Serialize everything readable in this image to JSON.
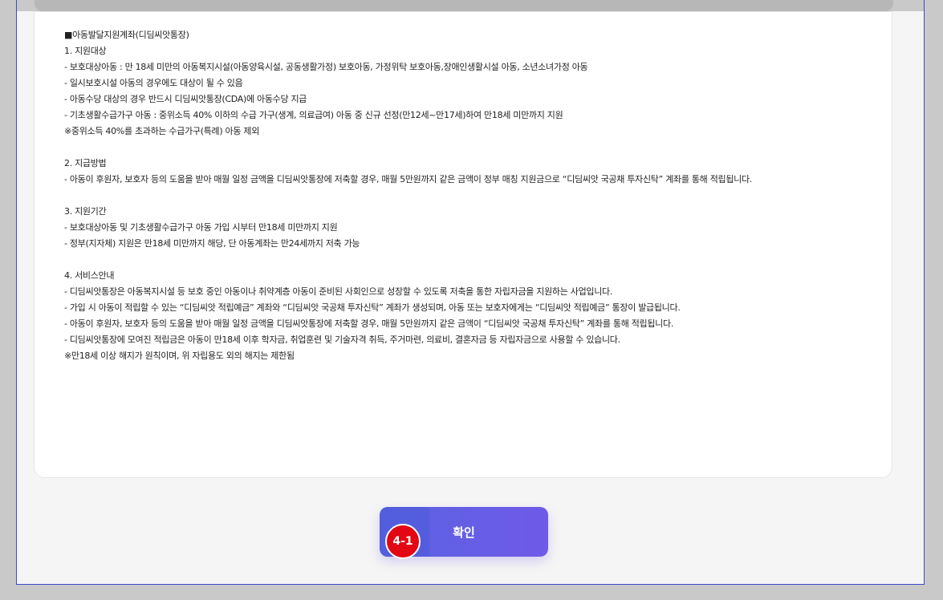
{
  "content": {
    "title": "■아동발달지원계좌(디딤씨앗통장)",
    "sections": [
      {
        "heading": "1. 지원대상",
        "lines": [
          "- 보호대상아동 : 만 18세 미만의 아동복지시설(아동양육시설, 공동생활가정) 보호아동, 가정위탁 보호아동,장애인생활시설 아동, 소년소녀가정 아동",
          "- 일시보호시설 아동의 경우에도 대상이 될 수 있음",
          "- 아동수당 대상의 경우 반드시 디딤씨앗통장(CDA)에 아동수당 지급",
          "- 기초생활수급가구 아동 : 중위소득 40% 이하의 수급 가구(생계, 의료급여) 아동 중 신규 선정(만12세~만17세)하여 만18세 미만까지 지원",
          " ※중위소득 40%를 초과하는 수급가구(특례) 아동 제외"
        ]
      },
      {
        "heading": "2. 지급방법",
        "lines": [
          "- 아동이 후원자, 보호자 등의 도움을 받아 매월 일정 금액을 디딤씨앗통장에 저축할 경우, 매월 5만원까지 같은 금액이 정부 매칭 지원금으로 “디딤씨앗 국공채 투자신탁” 계좌를 통해 적립됩니다."
        ]
      },
      {
        "heading": "3. 지원기간",
        "lines": [
          "- 보호대상아동 및 기초생활수급가구 아동 가입 시부터 만18세 미만까지 지원",
          "- 정부(지자체) 지원은 만18세 미만까지 해당, 단 아동계좌는 만24세까지 저축 가능"
        ]
      },
      {
        "heading": "4. 서비스안내",
        "lines": [
          "- 디딤씨앗통장은 아동복지시설 등 보호 중인 아동이나 취약계층 아동이 준비된 사회인으로 성장할 수 있도록 저축을 통한 자립자금을 지원하는 사업입니다.",
          "- 가입 시 아동이 적립할 수 있는 “디딤씨앗 적립예금” 계좌와 “디딤씨앗 국공채 투자신탁” 계좌가 생성되며, 아동 또는 보호자에게는 “디딤씨앗 적립예금” 통장이 발급됩니다.",
          "- 아동이 후원자, 보호자 등의 도움을 받아 매월 일정 금액을 디딤씨앗통장에 저축할 경우, 매월 5만원까지 같은 금액이 “디딤씨앗 국공채 투자신탁” 계좌를 통해 적립됩니다.",
          "- 디딤씨앗통장에 모여진 적립금은 아동이 만18세 이후 학자금, 취업훈련 및 기술자격 취득, 주거마련, 의료비, 결혼자금 등 자립자금으로 사용할 수 있습니다.",
          " ※만18세 이상 해지가 원칙이며, 위 자립용도 외의 해지는 제한됨"
        ]
      }
    ]
  },
  "actions": {
    "confirm_label": "확인"
  },
  "annotation": {
    "marker_label": "4-1",
    "marker_color": "#e30613"
  }
}
